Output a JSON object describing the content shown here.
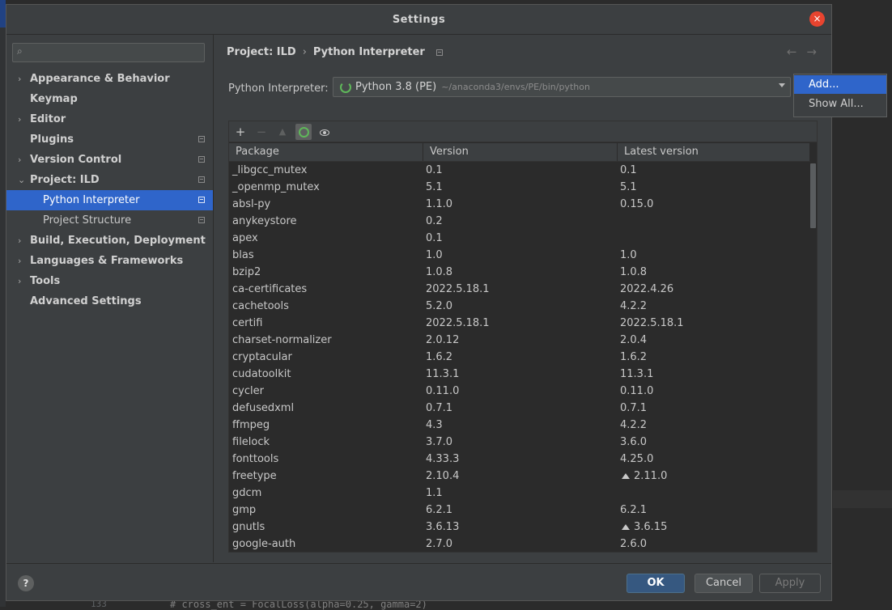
{
  "background": {
    "code_line": "# cross_ent = FocalLoss(alpha=0.25, gamma=2)",
    "line_number": "133"
  },
  "dialog": {
    "title": "Settings",
    "close_icon": "×"
  },
  "sidebar": {
    "search_placeholder": "",
    "items": [
      {
        "label": "Appearance & Behavior"
      },
      {
        "label": "Keymap"
      },
      {
        "label": "Editor"
      },
      {
        "label": "Plugins"
      },
      {
        "label": "Version Control"
      },
      {
        "label": "Project: ILD"
      },
      {
        "label": "Python Interpreter"
      },
      {
        "label": "Project Structure"
      },
      {
        "label": "Build, Execution, Deployment"
      },
      {
        "label": "Languages & Frameworks"
      },
      {
        "label": "Tools"
      },
      {
        "label": "Advanced Settings"
      }
    ]
  },
  "breadcrumb": {
    "project": "Project: ILD",
    "separator": "›",
    "page": "Python Interpreter"
  },
  "interpreter": {
    "label": "Python Interpreter:",
    "name": "Python 3.8 (PE)",
    "path": "~/anaconda3/envs/PE/bin/python"
  },
  "toolbar": {
    "add": "+",
    "remove": "−",
    "upgrade": "▲"
  },
  "table": {
    "headers": [
      "Package",
      "Version",
      "Latest version"
    ],
    "rows": [
      [
        "_libgcc_mutex",
        "0.1",
        "0.1",
        false
      ],
      [
        "_openmp_mutex",
        "5.1",
        "5.1",
        false
      ],
      [
        "absl-py",
        "1.1.0",
        "0.15.0",
        false
      ],
      [
        "anykeystore",
        "0.2",
        "",
        false
      ],
      [
        "apex",
        "0.1",
        "",
        false
      ],
      [
        "blas",
        "1.0",
        "1.0",
        false
      ],
      [
        "bzip2",
        "1.0.8",
        "1.0.8",
        false
      ],
      [
        "ca-certificates",
        "2022.5.18.1",
        "2022.4.26",
        false
      ],
      [
        "cachetools",
        "5.2.0",
        "4.2.2",
        false
      ],
      [
        "certifi",
        "2022.5.18.1",
        "2022.5.18.1",
        false
      ],
      [
        "charset-normalizer",
        "2.0.12",
        "2.0.4",
        false
      ],
      [
        "cryptacular",
        "1.6.2",
        "1.6.2",
        false
      ],
      [
        "cudatoolkit",
        "11.3.1",
        "11.3.1",
        false
      ],
      [
        "cycler",
        "0.11.0",
        "0.11.0",
        false
      ],
      [
        "defusedxml",
        "0.7.1",
        "0.7.1",
        false
      ],
      [
        "ffmpeg",
        "4.3",
        "4.2.2",
        false
      ],
      [
        "filelock",
        "3.7.0",
        "3.6.0",
        false
      ],
      [
        "fonttools",
        "4.33.3",
        "4.25.0",
        false
      ],
      [
        "freetype",
        "2.10.4",
        "2.11.0",
        true
      ],
      [
        "gdcm",
        "1.1",
        "",
        false
      ],
      [
        "gmp",
        "6.2.1",
        "6.2.1",
        false
      ],
      [
        "gnutls",
        "3.6.13",
        "3.6.15",
        true
      ],
      [
        "google-auth",
        "2.7.0",
        "2.6.0",
        false
      ]
    ]
  },
  "popup": {
    "items": [
      "Add...",
      "Show All..."
    ]
  },
  "footer": {
    "help": "?",
    "ok": "OK",
    "cancel": "Cancel",
    "apply": "Apply"
  }
}
